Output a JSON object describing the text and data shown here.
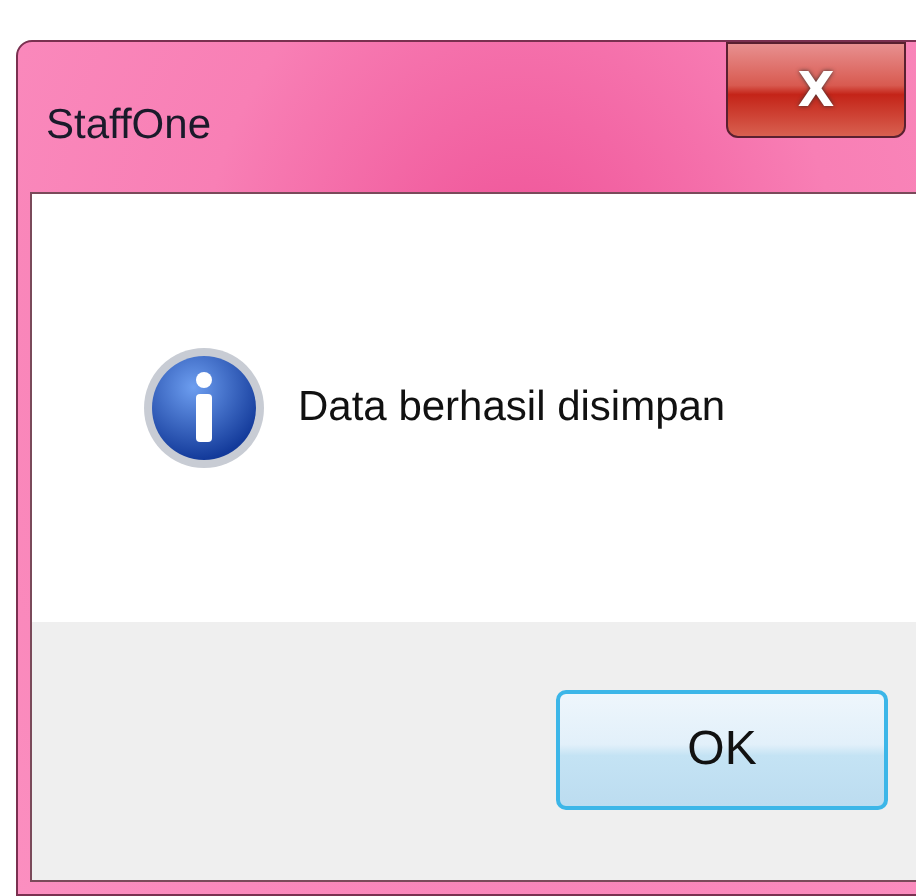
{
  "window": {
    "title": "StaffOne",
    "close": "X"
  },
  "message": {
    "text": "Data berhasil disimpan"
  },
  "buttons": [
    "OK"
  ]
}
